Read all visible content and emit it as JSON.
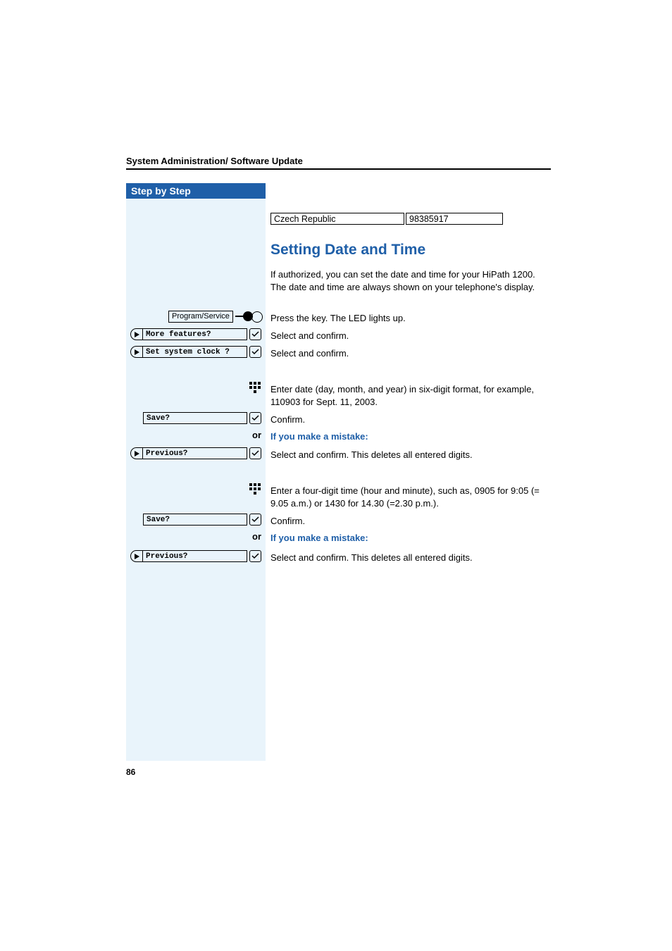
{
  "header": {
    "title": "System Administration/ Software Update"
  },
  "step_header": "Step by Step",
  "display": {
    "left": "Czech Republic",
    "right": "98385917"
  },
  "section": {
    "heading": "Setting Date and Time"
  },
  "intro": "If authorized, you can set the date and time for your HiPath 1200. The date and time are always shown on your telephone's display.",
  "steps": {
    "press_key": "Press the key. The LED lights up.",
    "prog_label": "Program/Service",
    "more_features": "More features?",
    "set_clock": "Set system clock ?",
    "select_confirm": "Select and confirm.",
    "enter_date": "Enter date (day, month, and year) in six-digit format, for example, 110903 for Sept. 11, 2003.",
    "save": "Save?",
    "confirm": "Confirm.",
    "or": "or",
    "mistake": "If you make a mistake:",
    "previous": "Previous?",
    "select_confirm_delete": "Select and confirm. This deletes all entered digits.",
    "enter_time": " Enter a four-digit time (hour and minute), such as, 0905 for 9:05 (= 9.05 a.m.) or 1430 for 14.30 (=2.30 p.m.).",
    "confirm2": "Confirm."
  },
  "page_number": "86"
}
